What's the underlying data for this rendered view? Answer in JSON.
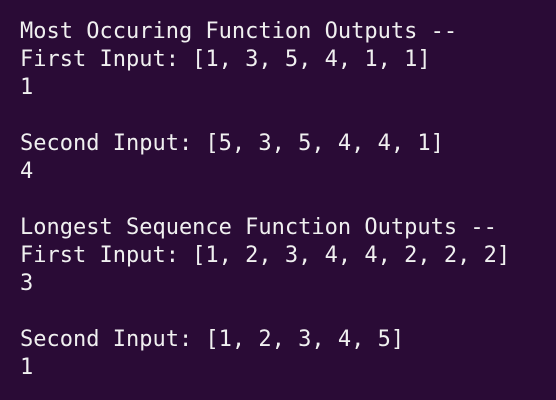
{
  "terminal": {
    "lines": [
      "Most Occuring Function Outputs --",
      "First Input: [1, 3, 5, 4, 1, 1]",
      "1",
      "",
      "Second Input: [5, 3, 5, 4, 4, 1]",
      "4",
      "",
      "Longest Sequence Function Outputs --",
      "First Input: [1, 2, 3, 4, 4, 2, 2, 2]",
      "3",
      "",
      "Second Input: [1, 2, 3, 4, 5]",
      "1"
    ]
  },
  "colors": {
    "background": "#2a0b36",
    "text": "#f0f0f0"
  }
}
